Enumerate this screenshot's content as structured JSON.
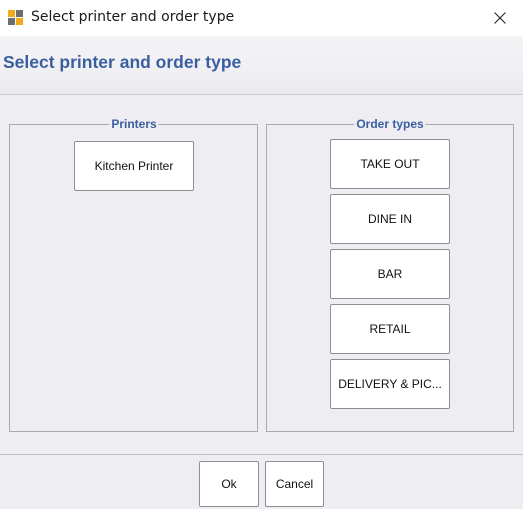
{
  "window": {
    "title": "Select printer and order type",
    "close_glyph": "✕"
  },
  "header": {
    "title": "Select printer and order type"
  },
  "printers": {
    "label": "Printers",
    "items": [
      "Kitchen Printer"
    ]
  },
  "order_types": {
    "label": "Order types",
    "items": [
      "TAKE OUT",
      "DINE IN",
      "BAR",
      "RETAIL",
      "DELIVERY & PIC..."
    ]
  },
  "footer": {
    "ok_label": "Ok",
    "cancel_label": "Cancel"
  },
  "colors": {
    "accent": "#3a5f9f",
    "background": "#eeedf1",
    "border": "#a9a9b3"
  },
  "icons": {
    "app": "app-icon",
    "close": "close-icon"
  }
}
